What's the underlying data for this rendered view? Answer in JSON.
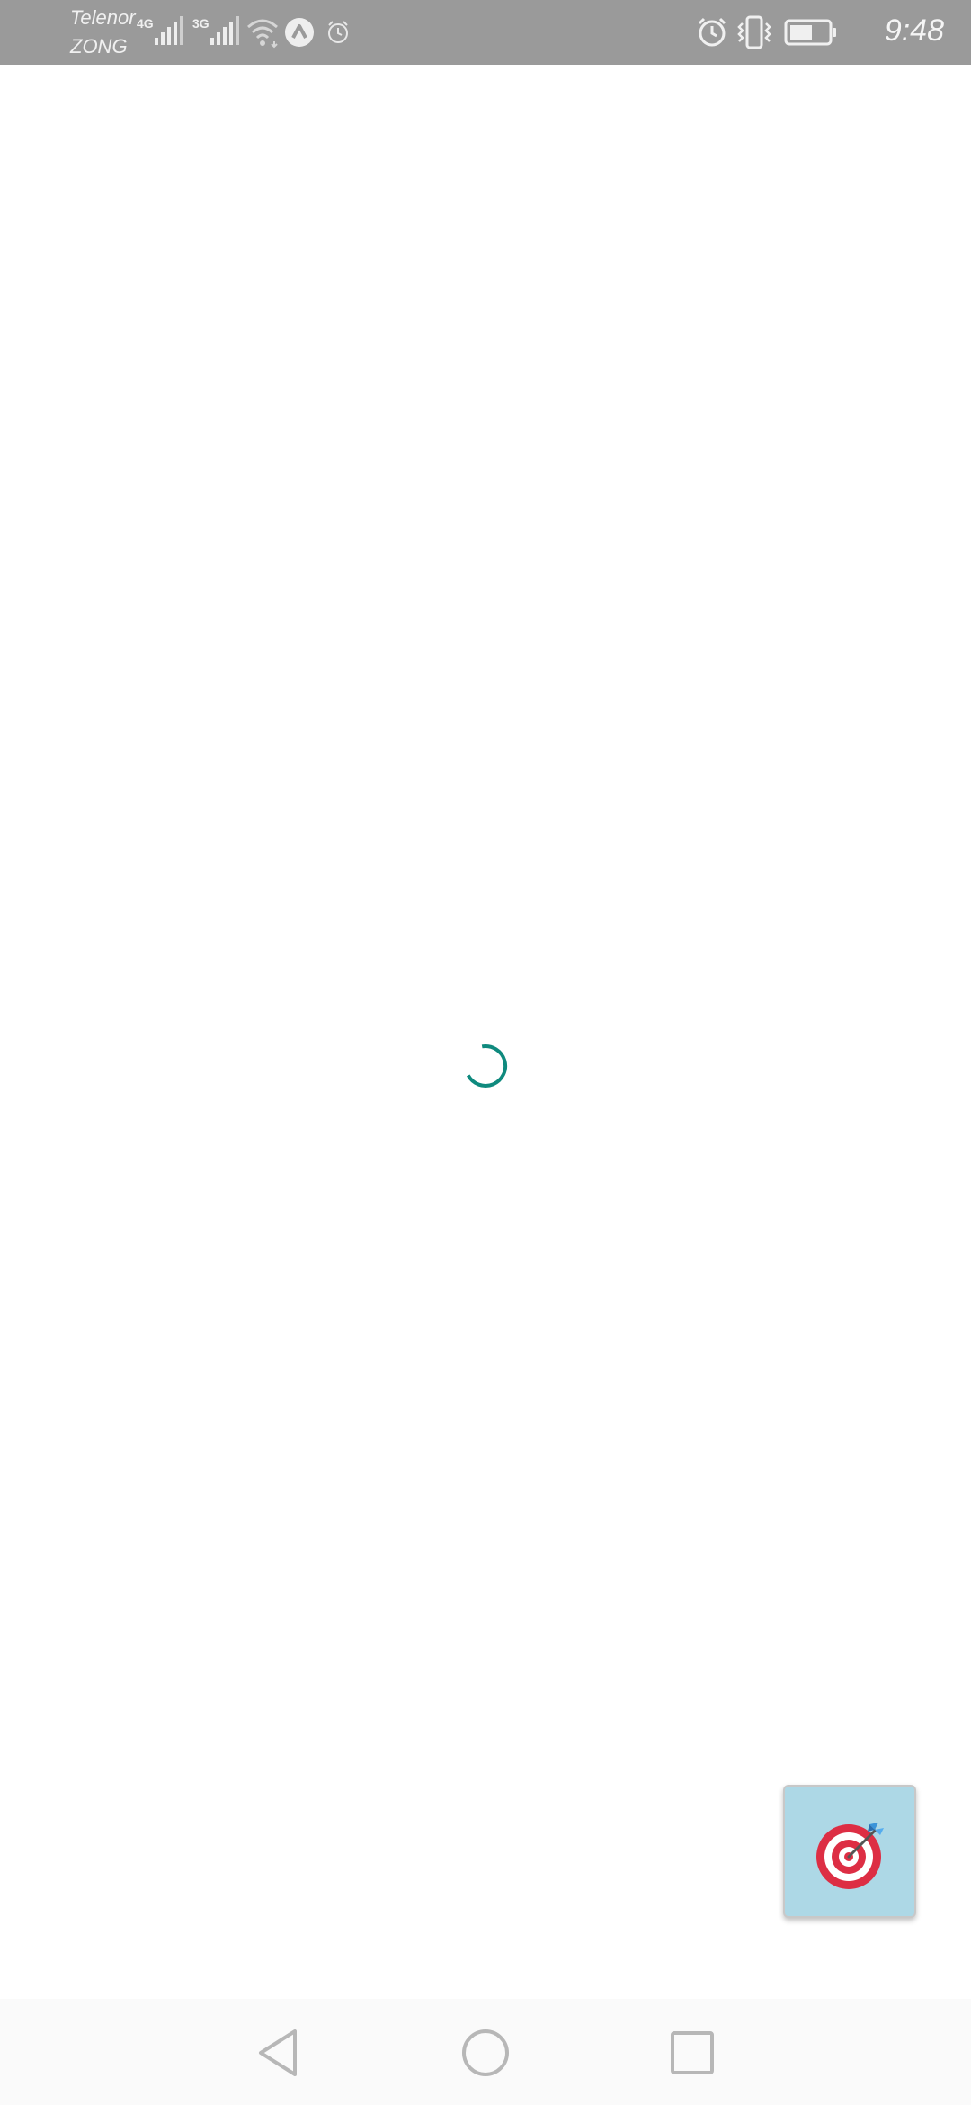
{
  "status_bar": {
    "carrier_1": "Telenor",
    "carrier_2": "ZONG",
    "network_1": "4G",
    "network_2": "3G",
    "time": "9:48",
    "icons": [
      "signal-icon",
      "signal-icon",
      "wifi-icon",
      "app-notification-icon",
      "alarm-icon",
      "alarm-icon",
      "vibrate-icon",
      "battery-icon"
    ]
  },
  "content": {
    "state": "loading",
    "spinner_color": "#0f8a7e"
  },
  "floating_button": {
    "icon": "target-dart-icon",
    "background": "#add8e6"
  },
  "navigation": {
    "buttons": [
      "back",
      "home",
      "recent-apps"
    ]
  }
}
